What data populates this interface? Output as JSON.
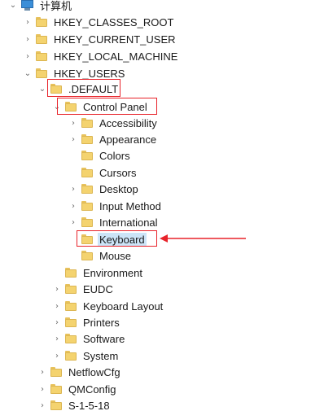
{
  "tree": {
    "root_label": "计算机",
    "hives": [
      "HKEY_CLASSES_ROOT",
      "HKEY_CURRENT_USER",
      "HKEY_LOCAL_MACHINE",
      "HKEY_USERS"
    ],
    "users_children": {
      "default": ".DEFAULT",
      "control_panel": "Control Panel",
      "control_panel_children": [
        "Accessibility",
        "Appearance",
        "Colors",
        "Cursors",
        "Desktop",
        "Input Method",
        "International",
        "Keyboard",
        "Mouse"
      ],
      "default_children": [
        "Environment",
        "EUDC",
        "Keyboard Layout",
        "Printers",
        "Software",
        "System"
      ],
      "siblings": [
        "NetflowCfg",
        "QMConfig",
        "S-1-5-18"
      ]
    }
  },
  "annotation": {
    "highlight_color": "#e8232a",
    "selection_color": "#cce4f7"
  }
}
